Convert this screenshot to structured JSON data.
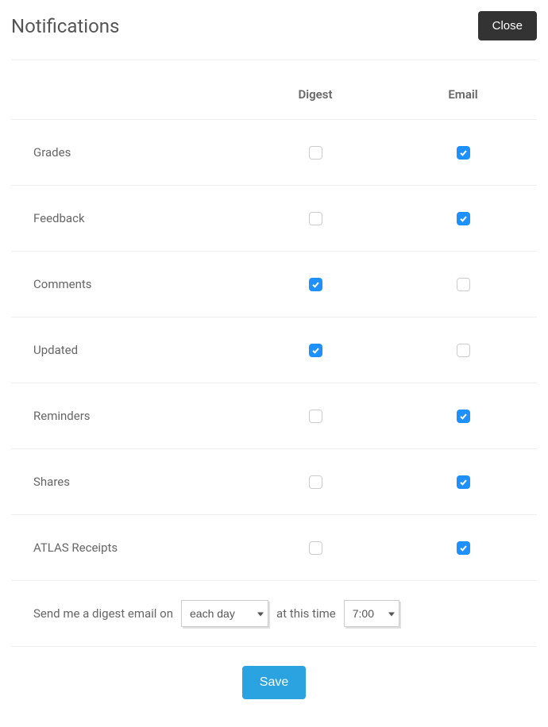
{
  "header": {
    "title": "Notifications",
    "close_label": "Close"
  },
  "columns": {
    "digest": "Digest",
    "email": "Email"
  },
  "rows": [
    {
      "label": "Grades",
      "digest": false,
      "email": true
    },
    {
      "label": "Feedback",
      "digest": false,
      "email": true
    },
    {
      "label": "Comments",
      "digest": true,
      "email": false
    },
    {
      "label": "Updated",
      "digest": true,
      "email": false
    },
    {
      "label": "Reminders",
      "digest": false,
      "email": true
    },
    {
      "label": "Shares",
      "digest": false,
      "email": true
    },
    {
      "label": "ATLAS Receipts",
      "digest": false,
      "email": true
    }
  ],
  "digest_settings": {
    "prefix": "Send me a digest email on",
    "frequency": "each day",
    "middle": "at this time",
    "time": "7:00"
  },
  "save_label": "Save"
}
